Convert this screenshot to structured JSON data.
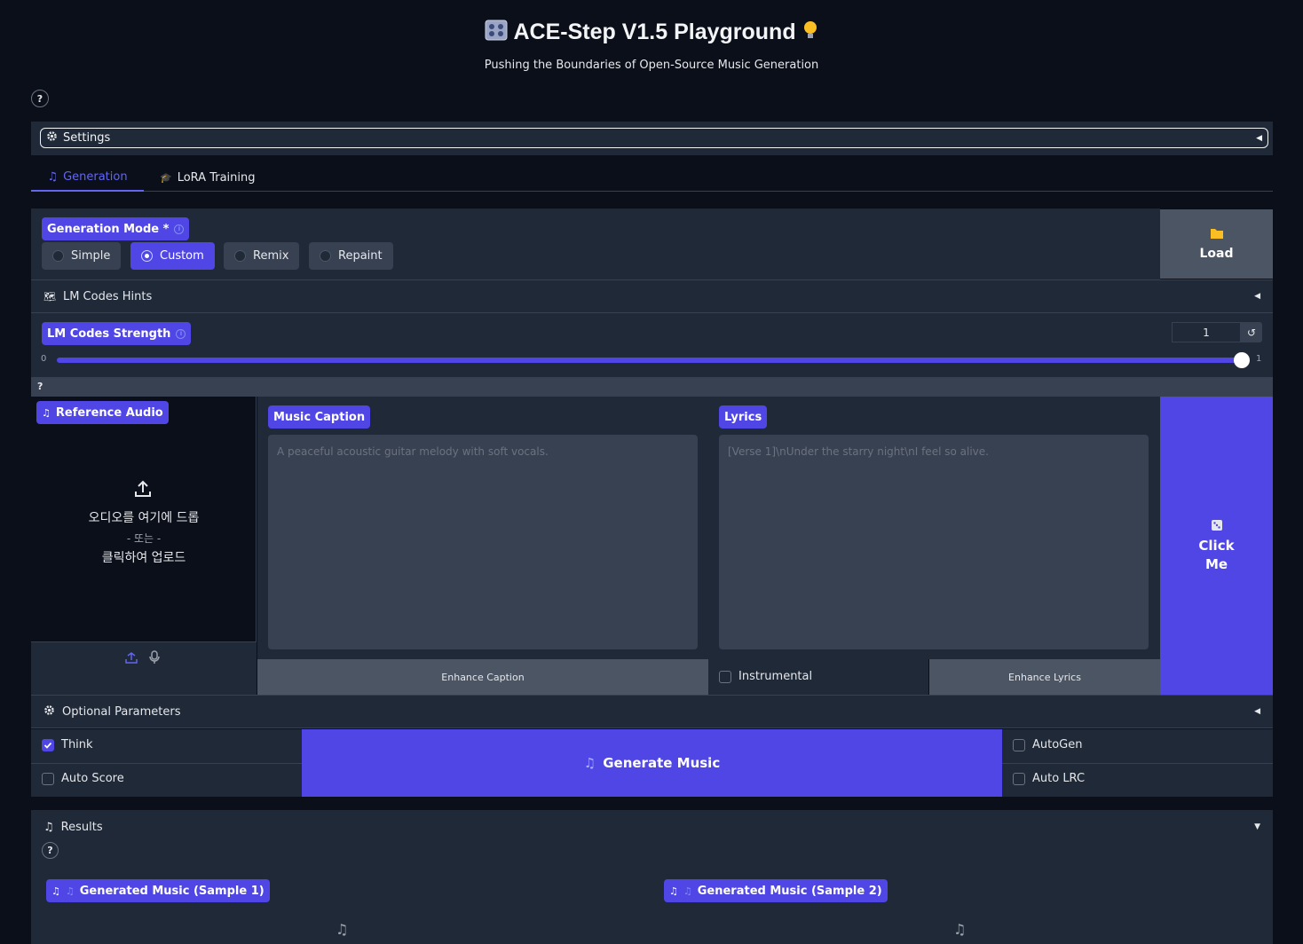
{
  "header": {
    "title": "ACE-Step V1.5 Playground",
    "subtitle": "Pushing the Boundaries of Open-Source Music Generation",
    "help": "?"
  },
  "settings": {
    "label": "Settings"
  },
  "tabs": [
    {
      "label": "Generation",
      "active": true,
      "icon": "music-note-icon"
    },
    {
      "label": "LoRA Training",
      "active": false,
      "icon": "graduation-cap-icon"
    }
  ],
  "generation_mode": {
    "label": "Generation Mode *",
    "options": [
      "Simple",
      "Custom",
      "Remix",
      "Repaint"
    ],
    "selected": "Custom"
  },
  "load_button": {
    "label": "Load",
    "icon": "folder-icon"
  },
  "lm_codes_hints": {
    "label": "LM Codes Hints"
  },
  "lm_codes_strength": {
    "label": "LM Codes Strength",
    "value": "1",
    "min": "0",
    "max": "1",
    "fraction": 1.0,
    "reset": "↺"
  },
  "help_bar": {
    "label": "?"
  },
  "reference_audio": {
    "label": "Reference Audio",
    "drop_text": "오디오를 여기에 드롭",
    "or_text": "- 또는 -",
    "click_text": "클릭하여 업로드"
  },
  "music_caption": {
    "label": "Music Caption",
    "placeholder": "A peaceful acoustic guitar melody with soft vocals."
  },
  "lyrics": {
    "label": "Lyrics",
    "placeholder": "[Verse 1]\\nUnder the starry night\\nI feel so alive."
  },
  "enhance_caption": {
    "label": "Enhance Caption"
  },
  "instrumental": {
    "label": "Instrumental",
    "checked": false
  },
  "enhance_lyrics": {
    "label": "Enhance Lyrics"
  },
  "click_me": {
    "line1": "Click",
    "line2": "Me",
    "icon": "dice-icon"
  },
  "optional_parameters": {
    "label": "Optional Parameters"
  },
  "think": {
    "label": "Think",
    "checked": true
  },
  "auto_score": {
    "label": "Auto Score",
    "checked": false
  },
  "generate": {
    "label": "Generate Music"
  },
  "autogen": {
    "label": "AutoGen",
    "checked": false
  },
  "auto_lrc": {
    "label": "Auto LRC",
    "checked": false
  },
  "results": {
    "label": "Results",
    "help": "?",
    "sample1": "Generated Music (Sample 1)",
    "sample2": "Generated Music (Sample 2)"
  },
  "colors": {
    "accent": "#4f46e5",
    "background": "#0b0f19",
    "panel": "#1f2937"
  }
}
